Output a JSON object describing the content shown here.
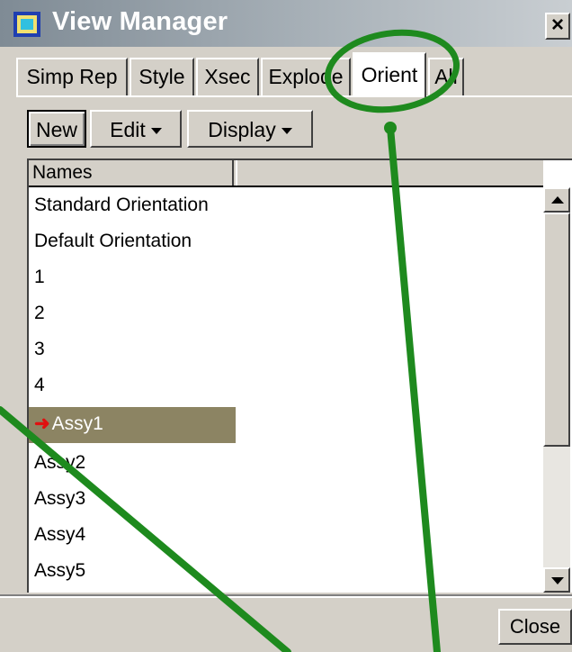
{
  "window": {
    "title": "View Manager",
    "close_glyph": "×"
  },
  "tabs": [
    {
      "label": "Simp Rep",
      "active": false
    },
    {
      "label": "Style",
      "active": false
    },
    {
      "label": "Xsec",
      "active": false
    },
    {
      "label": "Explode",
      "active": false
    },
    {
      "label": "Orient",
      "active": true
    },
    {
      "label": "All",
      "active": false
    }
  ],
  "toolbar": {
    "new_label": "New",
    "edit_label": "Edit",
    "display_label": "Display"
  },
  "list": {
    "column_header": "Names",
    "items": [
      {
        "label": "Standard Orientation",
        "selected": false
      },
      {
        "label": "Default Orientation",
        "selected": false
      },
      {
        "label": "1",
        "selected": false
      },
      {
        "label": "2",
        "selected": false
      },
      {
        "label": "3",
        "selected": false
      },
      {
        "label": "4",
        "selected": false
      },
      {
        "label": "Assy1",
        "selected": true,
        "icon": "red-arrow-icon"
      },
      {
        "label": "Assy2",
        "selected": false
      },
      {
        "label": "Assy3",
        "selected": false
      },
      {
        "label": "Assy4",
        "selected": false
      },
      {
        "label": "Assy5",
        "selected": false
      }
    ]
  },
  "footer": {
    "close_label": "Close"
  },
  "colors": {
    "selection": "#8c8463",
    "annotation": "#1e8a1e",
    "arrow": "#e01010"
  }
}
